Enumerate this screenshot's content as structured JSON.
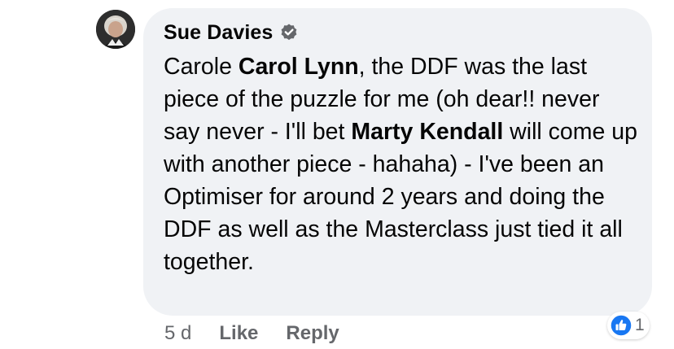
{
  "comment": {
    "author": "Sue Davies",
    "verified_icon": "verified-badge-icon",
    "text_segments": [
      {
        "text": "Carole ",
        "mention": false
      },
      {
        "text": "Carol Lynn",
        "mention": true
      },
      {
        "text": ", the DDF was the last piece of the puzzle for me (oh dear!! never say never - I'll bet ",
        "mention": false
      },
      {
        "text": "Marty Kendall",
        "mention": true
      },
      {
        "text": " will come up with another piece - hahaha)  - I've been an Optimiser for around 2 years and doing the DDF as well as the Masterclass just tied it all together.",
        "mention": false
      }
    ]
  },
  "actions": {
    "timestamp": "5 d",
    "like_label": "Like",
    "reply_label": "Reply"
  },
  "reactions": {
    "icon": "thumbs-up-icon",
    "count": "1",
    "color": "#1877f2"
  },
  "colors": {
    "bubble_bg": "#f0f2f5",
    "text": "#050505",
    "secondary_text": "#65676b",
    "accent": "#1877f2"
  }
}
